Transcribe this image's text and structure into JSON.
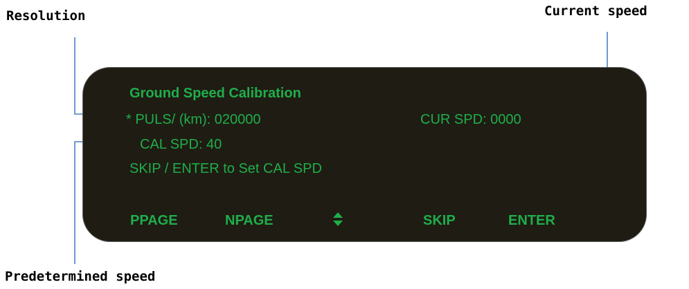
{
  "callouts": {
    "resolution": "Resolution",
    "current_speed": "Current speed",
    "predetermined_speed": "Predetermined speed"
  },
  "screen": {
    "title": "Ground Speed Calibration",
    "puls_line": "* PULS/ (km): 020000",
    "cur_spd": "CUR SPD: 0000",
    "cal_spd": "CAL SPD: 40",
    "message": "SKIP / ENTER to Set CAL SPD"
  },
  "softkeys": {
    "ppage": "PPAGE",
    "npage": "NPAGE",
    "updown_icon": "up-down-arrow-icon",
    "skip": "SKIP",
    "enter": "ENTER"
  },
  "colors": {
    "screen_background": "#1f1c13",
    "lcd_text": "#1fae4b",
    "callout_line": "#4a7fc1",
    "callout_text": "#000000"
  }
}
